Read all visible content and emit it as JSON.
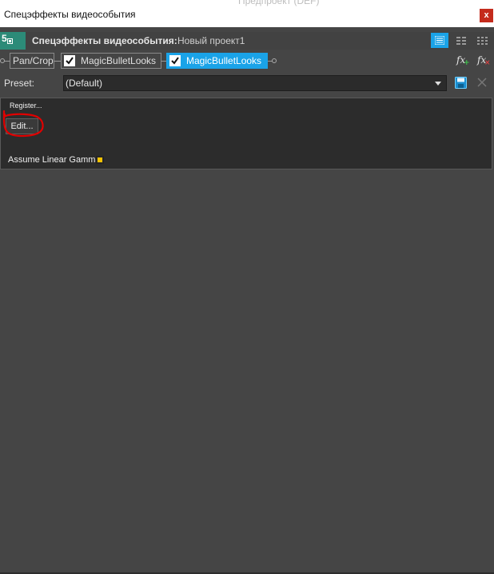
{
  "window": {
    "title": "Спецэффекты видеособытия",
    "background_title_fragment": "Предпроект (DEF)",
    "close_label": "x"
  },
  "header": {
    "event_number": "5",
    "label": "Спецэффекты видеособытия:",
    "project": "Новый проект1",
    "view_buttons": [
      "list-view-icon",
      "grid-view-icon",
      "tile-view-icon"
    ],
    "active_view": "list-view-icon"
  },
  "chain": {
    "items": [
      {
        "label": "Pan/Crop",
        "checked": null,
        "active": false
      },
      {
        "label": "MagicBulletLooks",
        "checked": true,
        "active": false
      },
      {
        "label": "MagicBulletLooks",
        "checked": true,
        "active": true
      }
    ],
    "add_icon": "fx-add-icon",
    "remove_icon": "fx-remove-icon"
  },
  "preset": {
    "label": "Preset:",
    "value": "(Default)"
  },
  "plugin": {
    "register_label": "Register...",
    "edit_label": "Edit...",
    "gamma_label": "Assume Linear Gamma",
    "gamma_checked": true
  },
  "colors": {
    "accent": "#1aa3e8",
    "badge": "#2c8b78",
    "close": "#c42b1c",
    "checkbox_yellow": "#f5c300",
    "annotation": "#e00000"
  }
}
